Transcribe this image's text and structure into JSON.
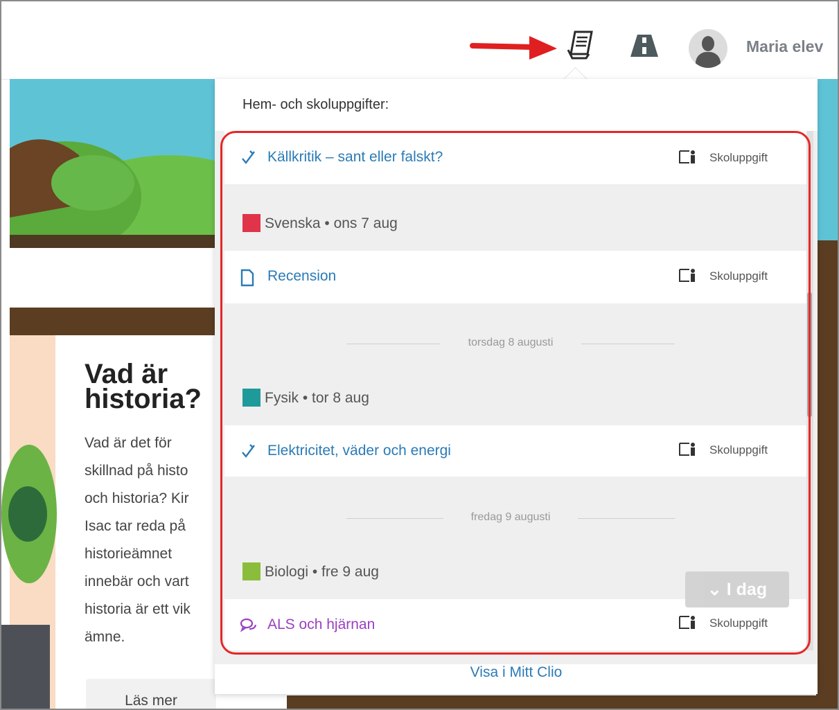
{
  "header": {
    "user_name": "Maria elev"
  },
  "background_card": {
    "title": "Vad är historia?",
    "text": "Vad är det för\nskillnad på histo\noch historia? Kir\nIsac tar reda på\nhistorieämnet\ninnebär och vart\nhistoria är ett vik\nämne.",
    "read_more": "Läs mer"
  },
  "panel": {
    "title": "Hem- och skoluppgifter:",
    "view_link": "Visa i Mitt Clio",
    "today_button": "⌄ I dag",
    "tasks": [
      {
        "title": "Källkritik – sant eller falskt?",
        "icon": "pencil-check-icon",
        "tag": "Skoluppgift"
      },
      {
        "title": "Recension",
        "icon": "document-icon",
        "tag": "Skoluppgift"
      },
      {
        "title": "Elektricitet, väder och energi",
        "icon": "pencil-check-icon",
        "tag": "Skoluppgift"
      },
      {
        "title": "ALS och hjärnan",
        "icon": "chat-bubbles-icon",
        "tag": "Skoluppgift"
      }
    ],
    "subjects": [
      {
        "label": "Svenska • ons 7 aug",
        "color": "#e0344a"
      },
      {
        "label": "Fysik • tor 8 aug",
        "color": "#1f9a9a"
      },
      {
        "label": "Biologi • fre 9 aug",
        "color": "#8bbd3c"
      }
    ],
    "date_separators": [
      "torsdag 8 augusti",
      "fredag 9 augusti"
    ]
  },
  "colors": {
    "link_blue": "#2a7bb6",
    "purple": "#9a3fc0",
    "highlight_red": "#e52727"
  }
}
